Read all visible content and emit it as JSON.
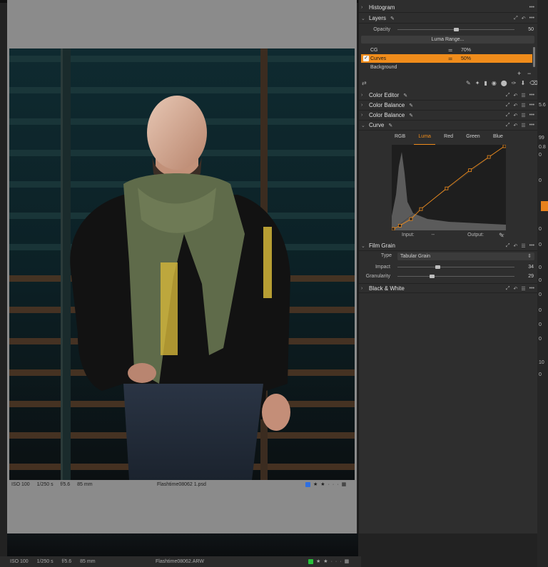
{
  "viewer": {
    "iso": "ISO 100",
    "shutter": "1/250 s",
    "aperture": "f/5.6",
    "focal": "85 mm",
    "filename": "Flashtime08062 1.psd",
    "color_tag": "#2f6fe0",
    "rating": 2
  },
  "background_browser": {
    "iso": "ISO 100",
    "shutter": "1/250 s",
    "aperture": "f/5.6",
    "focal": "85 mm",
    "filename": "Flashtime08062.ARW",
    "color_tag": "#27c03a",
    "rating": 2,
    "side_values": [
      "5.6",
      "99",
      "0.8",
      "0",
      "0",
      "0",
      "0",
      "0",
      "0",
      "0",
      "0",
      "0",
      "0",
      "10",
      "0"
    ]
  },
  "panel": {
    "histogram": {
      "title": "Histogram"
    },
    "layers": {
      "title": "Layers",
      "opacity_label": "Opacity",
      "opacity_value": "50",
      "opacity_level": 0.5,
      "luma_range_label": "Luma Range...",
      "items": [
        {
          "name": "CG",
          "opacity": "70%",
          "selected": false,
          "checked": false
        },
        {
          "name": "Curves",
          "opacity": "50%",
          "selected": true,
          "checked": true
        },
        {
          "name": "Background",
          "opacity": "",
          "selected": false,
          "checked": false
        }
      ]
    },
    "collapsed_tools": [
      {
        "title": "Color Editor"
      },
      {
        "title": "Color Balance"
      },
      {
        "title": "Color Balance"
      }
    ],
    "curve": {
      "title": "Curve",
      "tabs": [
        "RGB",
        "Luma",
        "Red",
        "Green",
        "Blue"
      ],
      "active_tab": "Luma",
      "input_label": "Input:",
      "input_value": "--",
      "output_label": "Output:",
      "output_value": "--",
      "points": [
        [
          0,
          0
        ],
        [
          0.06,
          0.04
        ],
        [
          0.16,
          0.12
        ],
        [
          0.25,
          0.24
        ],
        [
          0.48,
          0.49
        ],
        [
          0.69,
          0.71
        ],
        [
          0.86,
          0.87
        ],
        [
          1,
          1
        ]
      ]
    },
    "film_grain": {
      "title": "Film Grain",
      "type_label": "Type",
      "type_value": "Tabular Grain",
      "impact_label": "Impact",
      "impact_value": "34",
      "impact_level": 0.34,
      "granularity_label": "Granularity",
      "granularity_value": "29",
      "granularity_level": 0.29
    },
    "black_white": {
      "title": "Black & White"
    }
  },
  "colors": {
    "accent": "#f08c1b",
    "panel_bg": "#2e2e2e",
    "viewer_bg": "#8b8b8b"
  },
  "icons": {
    "chevron_right": "›",
    "chevron_down": "⌄",
    "more": "•••",
    "picker": "eyedropper-icon",
    "reset": "reset-icon",
    "copy": "copy-apply-icon"
  }
}
